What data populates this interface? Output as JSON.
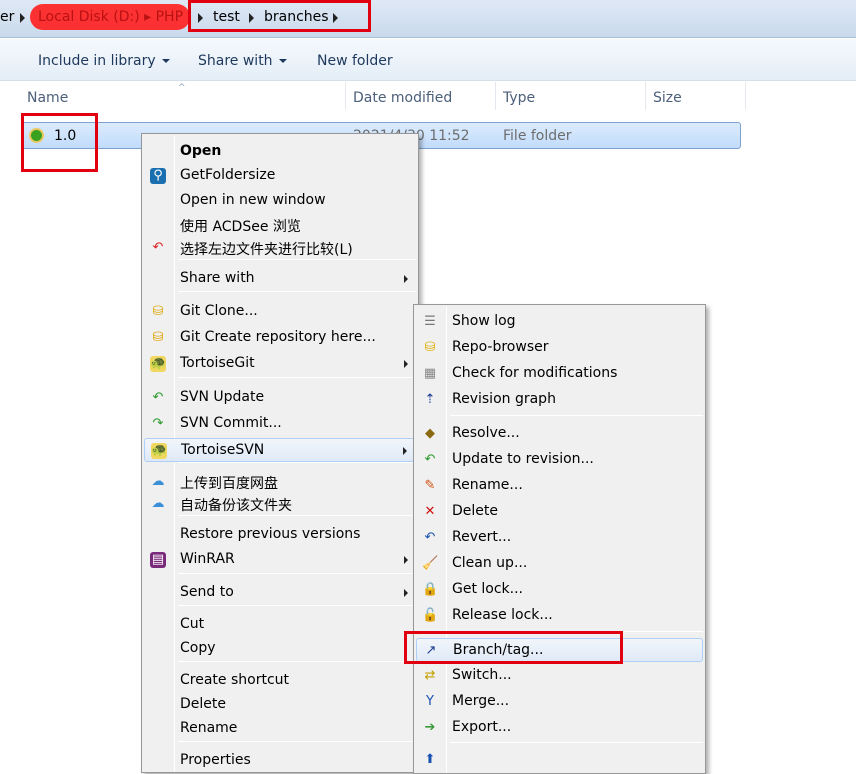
{
  "address_bar": {
    "partial_left": "er",
    "redacted": "Local Disk (D:) ▸ PHP",
    "crumbs": [
      "test",
      "branches"
    ]
  },
  "toolbar": {
    "include_in_library": "Include in library",
    "share_with": "Share with",
    "new_folder": "New folder"
  },
  "columns": {
    "name": "Name",
    "date_modified": "Date modified",
    "type": "Type",
    "size": "Size"
  },
  "file": {
    "name": "1.0",
    "date_modified": "2021/4/30 11:52",
    "type": "File folder"
  },
  "context_menu": [
    {
      "label": "Open",
      "bold": true
    },
    {
      "label": "GetFoldersize",
      "icon": "magnifier-icon"
    },
    {
      "label": "Open in new window"
    },
    {
      "label": "使用 ACDSee 浏览"
    },
    {
      "label": "选择左边文件夹进行比较(L)",
      "icon": "compare-arrow-icon"
    },
    {
      "sep": true
    },
    {
      "label": "Share with",
      "submenu": true
    },
    {
      "sep": true
    },
    {
      "label": "Git Clone...",
      "icon": "git-clone-icon"
    },
    {
      "label": "Git Create repository here...",
      "icon": "git-create-icon"
    },
    {
      "label": "TortoiseGit",
      "icon": "tortoisegit-icon",
      "submenu": true
    },
    {
      "sep": true
    },
    {
      "label": "SVN Update",
      "icon": "svn-update-icon"
    },
    {
      "label": "SVN Commit...",
      "icon": "svn-commit-icon"
    },
    {
      "label": "TortoiseSVN",
      "icon": "tortoisesvn-icon",
      "submenu": true,
      "active": true
    },
    {
      "sep": true
    },
    {
      "label": "上传到百度网盘",
      "icon": "baidu-icon"
    },
    {
      "label": "自动备份该文件夹",
      "icon": "baidu-icon"
    },
    {
      "sep": true
    },
    {
      "label": "Restore previous versions"
    },
    {
      "label": "WinRAR",
      "icon": "winrar-icon",
      "submenu": true
    },
    {
      "sep": true
    },
    {
      "label": "Send to",
      "submenu": true
    },
    {
      "sep": true
    },
    {
      "label": "Cut"
    },
    {
      "label": "Copy"
    },
    {
      "sep": true
    },
    {
      "label": "Create shortcut"
    },
    {
      "label": "Delete"
    },
    {
      "label": "Rename"
    },
    {
      "sep": true
    },
    {
      "label": "Properties"
    }
  ],
  "svn_submenu": [
    {
      "label": "Show log",
      "icon": "log-icon"
    },
    {
      "label": "Repo-browser",
      "icon": "repo-browser-icon"
    },
    {
      "label": "Check for modifications",
      "icon": "check-modifications-icon"
    },
    {
      "label": "Revision graph",
      "icon": "revision-graph-icon"
    },
    {
      "sep": true
    },
    {
      "label": "Resolve...",
      "icon": "resolve-icon"
    },
    {
      "label": "Update to revision...",
      "icon": "update-icon"
    },
    {
      "label": "Rename...",
      "icon": "rename-icon"
    },
    {
      "label": "Delete",
      "icon": "delete-icon"
    },
    {
      "label": "Revert...",
      "icon": "revert-icon"
    },
    {
      "label": "Clean up...",
      "icon": "cleanup-icon"
    },
    {
      "label": "Get lock...",
      "icon": "lock-icon"
    },
    {
      "label": "Release lock...",
      "icon": "unlock-icon"
    },
    {
      "sep": true
    },
    {
      "label": "Branch/tag...",
      "icon": "branch-icon",
      "active": true
    },
    {
      "label": "Switch...",
      "icon": "switch-icon"
    },
    {
      "label": "Merge...",
      "icon": "merge-icon"
    },
    {
      "label": "Export...",
      "icon": "export-icon"
    },
    {
      "sep": true
    },
    {
      "label": "",
      "icon": "import-icon"
    }
  ],
  "colors": {
    "highlight_box": "#e00010",
    "selection": "#c1dcfc"
  }
}
